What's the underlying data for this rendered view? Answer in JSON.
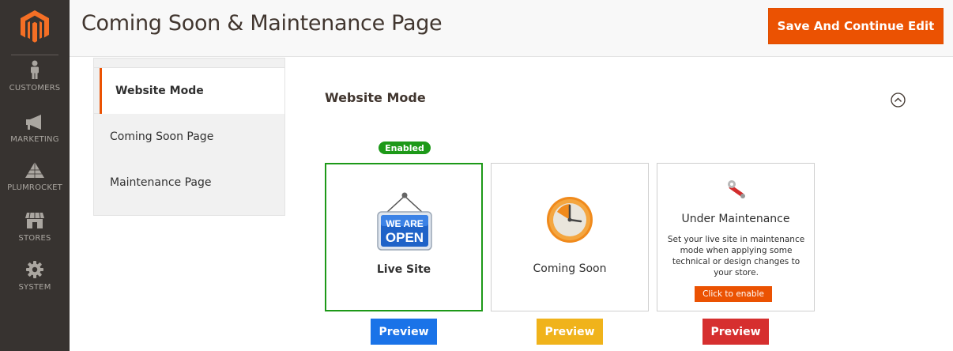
{
  "sidebar": {
    "items": [
      {
        "label": "CUSTOMERS",
        "icon": "person-icon"
      },
      {
        "label": "MARKETING",
        "icon": "megaphone-icon"
      },
      {
        "label": "PLUMROCKET",
        "icon": "pyramid-icon"
      },
      {
        "label": "STORES",
        "icon": "storefront-icon"
      },
      {
        "label": "SYSTEM",
        "icon": "gear-icon"
      }
    ]
  },
  "header": {
    "title": "Coming Soon & Maintenance Page",
    "save_label": "Save And Continue Edit"
  },
  "tabs": [
    {
      "label": "Website Mode",
      "active": true
    },
    {
      "label": "Coming Soon Page",
      "active": false
    },
    {
      "label": "Maintenance Page",
      "active": false
    }
  ],
  "section": {
    "title": "Website Mode"
  },
  "cards": {
    "enabled_badge": "Enabled",
    "live": {
      "label": "Live Site",
      "sign_top": "WE ARE",
      "sign_bottom": "OPEN",
      "preview": "Preview"
    },
    "coming": {
      "label": "Coming Soon",
      "preview": "Preview"
    },
    "maintenance": {
      "label": "Under Maintenance",
      "description": "Set your live site in maintenance mode when applying some technical or design changes to your store.",
      "enable_label": "Click to enable",
      "preview": "Preview"
    }
  },
  "colors": {
    "accent": "#eb5202",
    "sidebar": "#373330",
    "enabled": "#1d9918",
    "preview_live": "#1a73e8",
    "preview_coming": "#f0b31b",
    "preview_maintenance": "#d62f2f"
  }
}
